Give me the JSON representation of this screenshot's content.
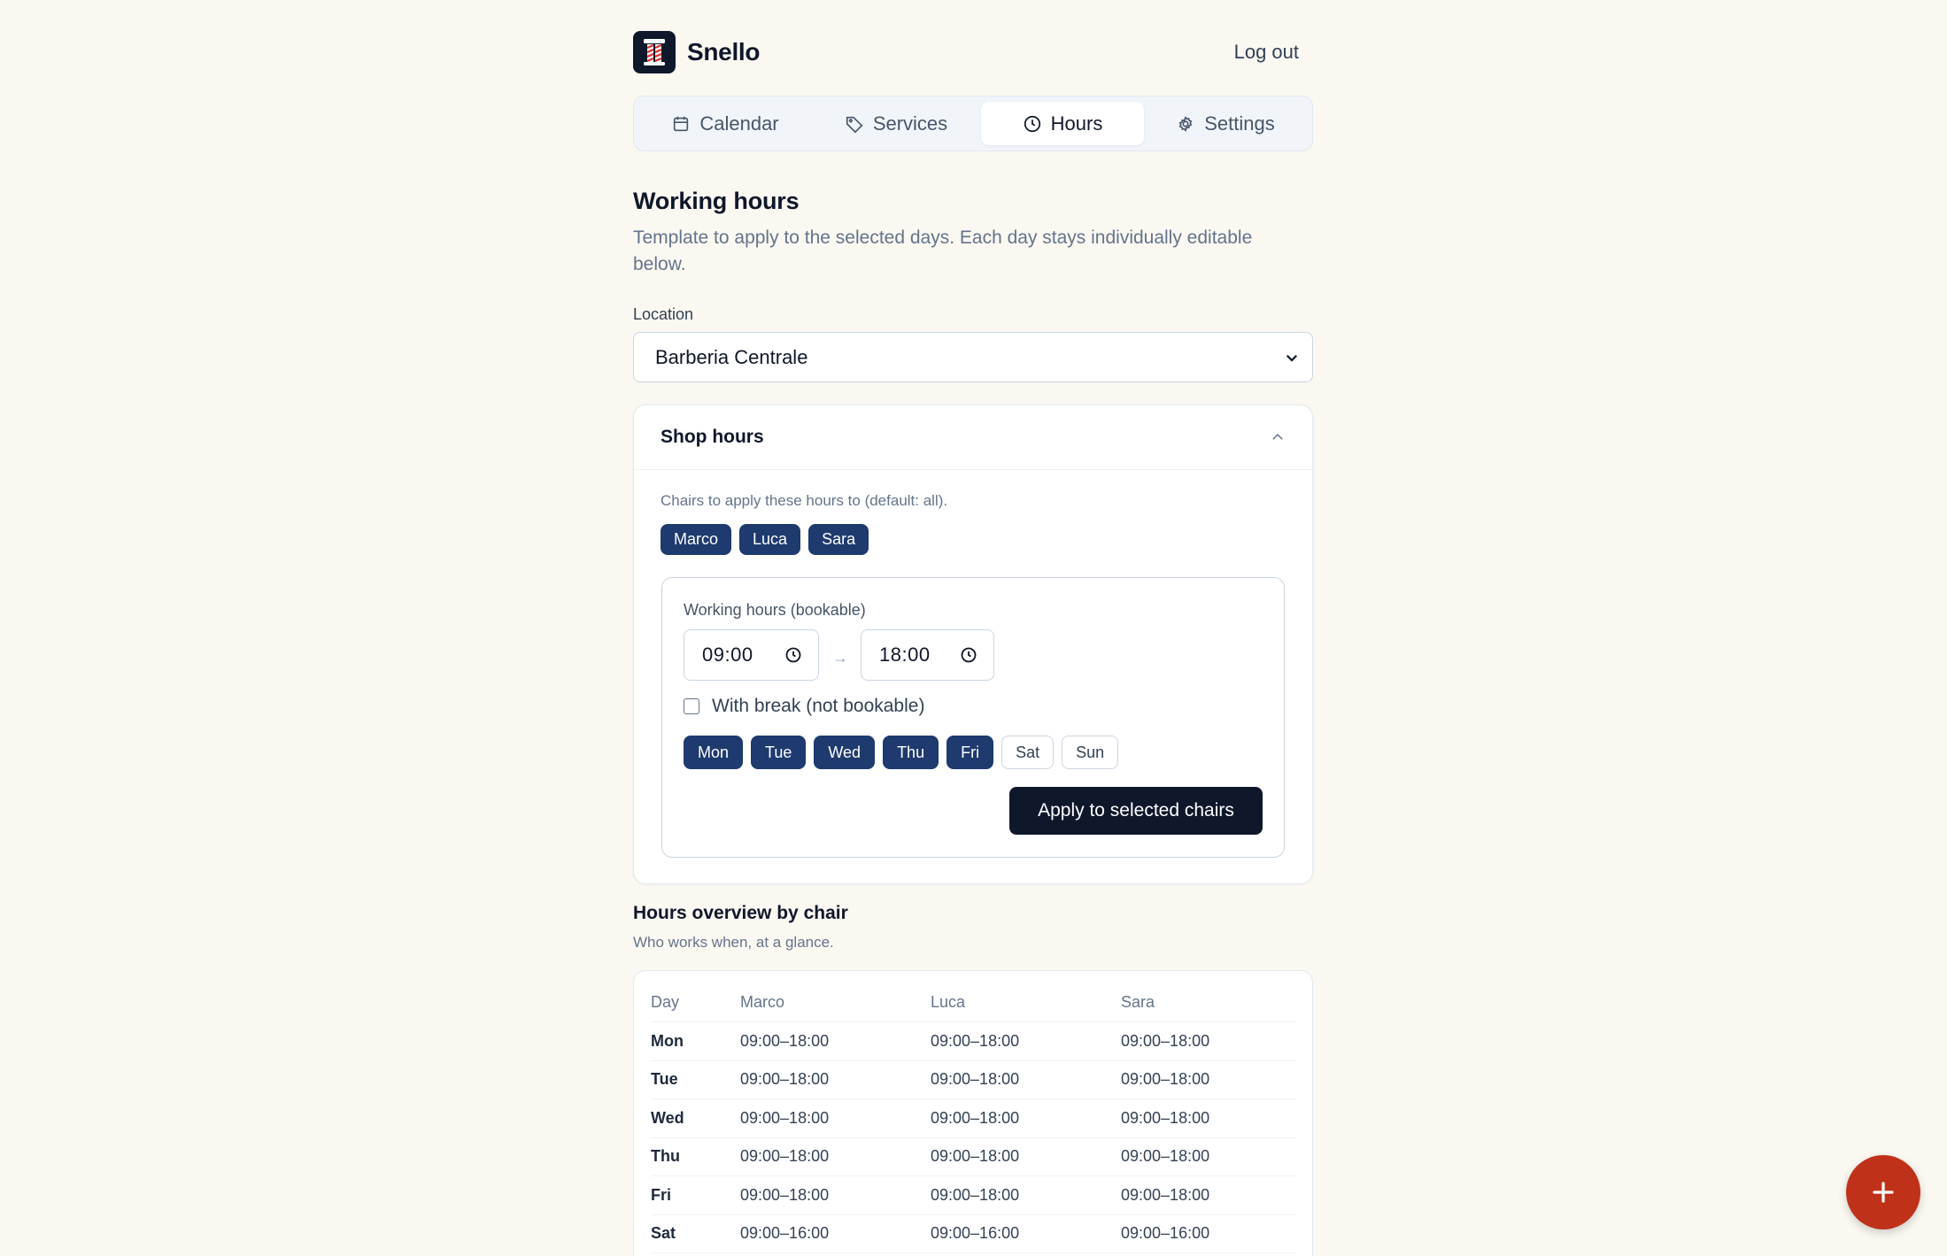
{
  "app": {
    "name": "Snello",
    "logout_label": "Log out"
  },
  "tabs": [
    {
      "label": "Calendar",
      "icon": "calendar-icon",
      "active": false
    },
    {
      "label": "Services",
      "icon": "tag-icon",
      "active": false
    },
    {
      "label": "Hours",
      "icon": "clock-icon",
      "active": true
    },
    {
      "label": "Settings",
      "icon": "gear-icon",
      "active": false
    }
  ],
  "working_hours": {
    "title": "Working hours",
    "description": "Template to apply to the selected days. Each day stays individually editable below."
  },
  "location": {
    "label": "Location",
    "value": "Barberia Centrale"
  },
  "shop_hours": {
    "title": "Shop hours",
    "chairs_label": "Chairs to apply these hours to (default: all).",
    "chairs": [
      "Marco",
      "Luca",
      "Sara"
    ],
    "working_hours_label": "Working hours (bookable)",
    "start_time": "09:00",
    "end_time": "18:00",
    "arrow": "→",
    "break_label": "With break (not bookable)",
    "break_checked": false,
    "days": [
      {
        "label": "Mon",
        "selected": true
      },
      {
        "label": "Tue",
        "selected": true
      },
      {
        "label": "Wed",
        "selected": true
      },
      {
        "label": "Thu",
        "selected": true
      },
      {
        "label": "Fri",
        "selected": true
      },
      {
        "label": "Sat",
        "selected": false
      },
      {
        "label": "Sun",
        "selected": false
      }
    ],
    "apply_label": "Apply to selected chairs"
  },
  "overview": {
    "title": "Hours overview by chair",
    "subtitle": "Who works when, at a glance.",
    "columns": [
      "Day",
      "Marco",
      "Luca",
      "Sara"
    ],
    "rows": [
      [
        "Mon",
        "09:00–18:00",
        "09:00–18:00",
        "09:00–18:00"
      ],
      [
        "Tue",
        "09:00–18:00",
        "09:00–18:00",
        "09:00–18:00"
      ],
      [
        "Wed",
        "09:00–18:00",
        "09:00–18:00",
        "09:00–18:00"
      ],
      [
        "Thu",
        "09:00–18:00",
        "09:00–18:00",
        "09:00–18:00"
      ],
      [
        "Fri",
        "09:00–18:00",
        "09:00–18:00",
        "09:00–18:00"
      ],
      [
        "Sat",
        "09:00–16:00",
        "09:00–16:00",
        "09:00–16:00"
      ]
    ]
  },
  "fab": {
    "icon": "plus-icon"
  },
  "colors": {
    "background": "#faf8f1",
    "primary": "#1e3a6e",
    "dark": "#0f172a",
    "accent": "#c0311a"
  }
}
